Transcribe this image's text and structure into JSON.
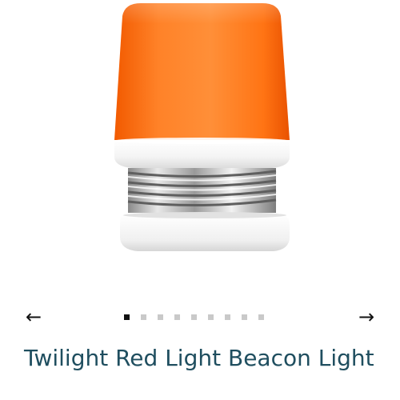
{
  "product": {
    "title": "Twilight Red Light Beacon Light",
    "image_alt": "Twilight Red Light Beacon Light bulb"
  },
  "carousel": {
    "prev_label": "←",
    "next_label": "→",
    "slide_count": 9,
    "active_index": 0
  },
  "colors": {
    "title": "#1f4e5f",
    "dot_active": "#111111",
    "dot_inactive": "#c9c9c9",
    "lamp_orange": "#ff7a1a"
  },
  "icons": {
    "prev": "arrow-left-icon",
    "next": "arrow-right-icon"
  }
}
